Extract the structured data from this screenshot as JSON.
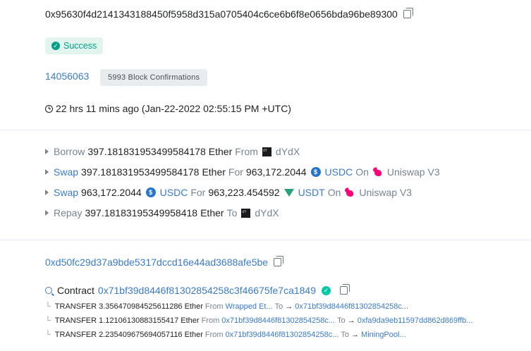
{
  "transaction": {
    "hash": "0x95630f4d2141343188450f5958d315a0705404c6ce6b6f8e0656bda96be89300",
    "status": "Success",
    "block_number": "14056063",
    "block_confirmations": "5993 Block Confirmations",
    "timestamp": "22 hrs 11 mins ago (Jan-22-2022 02:55:15 PM +UTC)"
  },
  "actions": [
    {
      "verb": "Borrow",
      "amount": "397.181831953499584178",
      "token": "Ether",
      "prep": "From",
      "platform": "dYdX",
      "platform_icon": "dydx-icon"
    },
    {
      "verb": "Swap",
      "amount": "397.181831953499584178",
      "token": "Ether",
      "prep": "For",
      "amount2": "963,172.2044",
      "token2": "USDC",
      "token2_icon": "usdc-icon",
      "on": "On",
      "platform": "Uniswap V3",
      "platform_icon": "uniswap-icon"
    },
    {
      "verb": "Swap",
      "amount": "963,172.2044",
      "token": "USDC",
      "token_icon": "usdc-icon",
      "prep": "For",
      "amount2": "963,223.454592",
      "token2": "USDT",
      "token2_icon": "usdt-icon",
      "on": "On",
      "platform": "Uniswap V3",
      "platform_icon": "uniswap-icon"
    },
    {
      "verb": "Repay",
      "amount": "397.18183195349958418",
      "token": "Ether",
      "prep": "To",
      "platform": "dYdX",
      "platform_icon": "dydx-icon"
    }
  ],
  "to_address": "0xd50fc29d37a9bde5317dccd16e44ad3688afe5be",
  "contract": {
    "label": "Contract",
    "address": "0x71bf39d8446f81302854258c3f46675fe7ca1849"
  },
  "transfers": [
    {
      "label": "TRANSFER",
      "amount": "3.356470984525611286",
      "token": "Ether",
      "from_label": "From",
      "from": "Wrapped Et...",
      "to_label": "To",
      "to": "0x71bf39d8446f81302854258c..."
    },
    {
      "label": "TRANSFER",
      "amount": "1.12106130883155417",
      "token": "Ether",
      "from_label": "From",
      "from": "0x71bf39d8446f81302854258c...",
      "to_label": "To",
      "to": "0xfa9da9eb11597dd862d869ffb..."
    },
    {
      "label": "TRANSFER",
      "amount": "2.235409675694057116",
      "token": "Ether",
      "from_label": "From",
      "from": "0x71bf39d8446f81302854258c...",
      "to_label": "To",
      "to": "MiningPool..."
    }
  ],
  "colors": {
    "link": "#3a7bc8",
    "success": "#00a186",
    "muted": "#77838f",
    "divider": "#e7eaf3"
  }
}
